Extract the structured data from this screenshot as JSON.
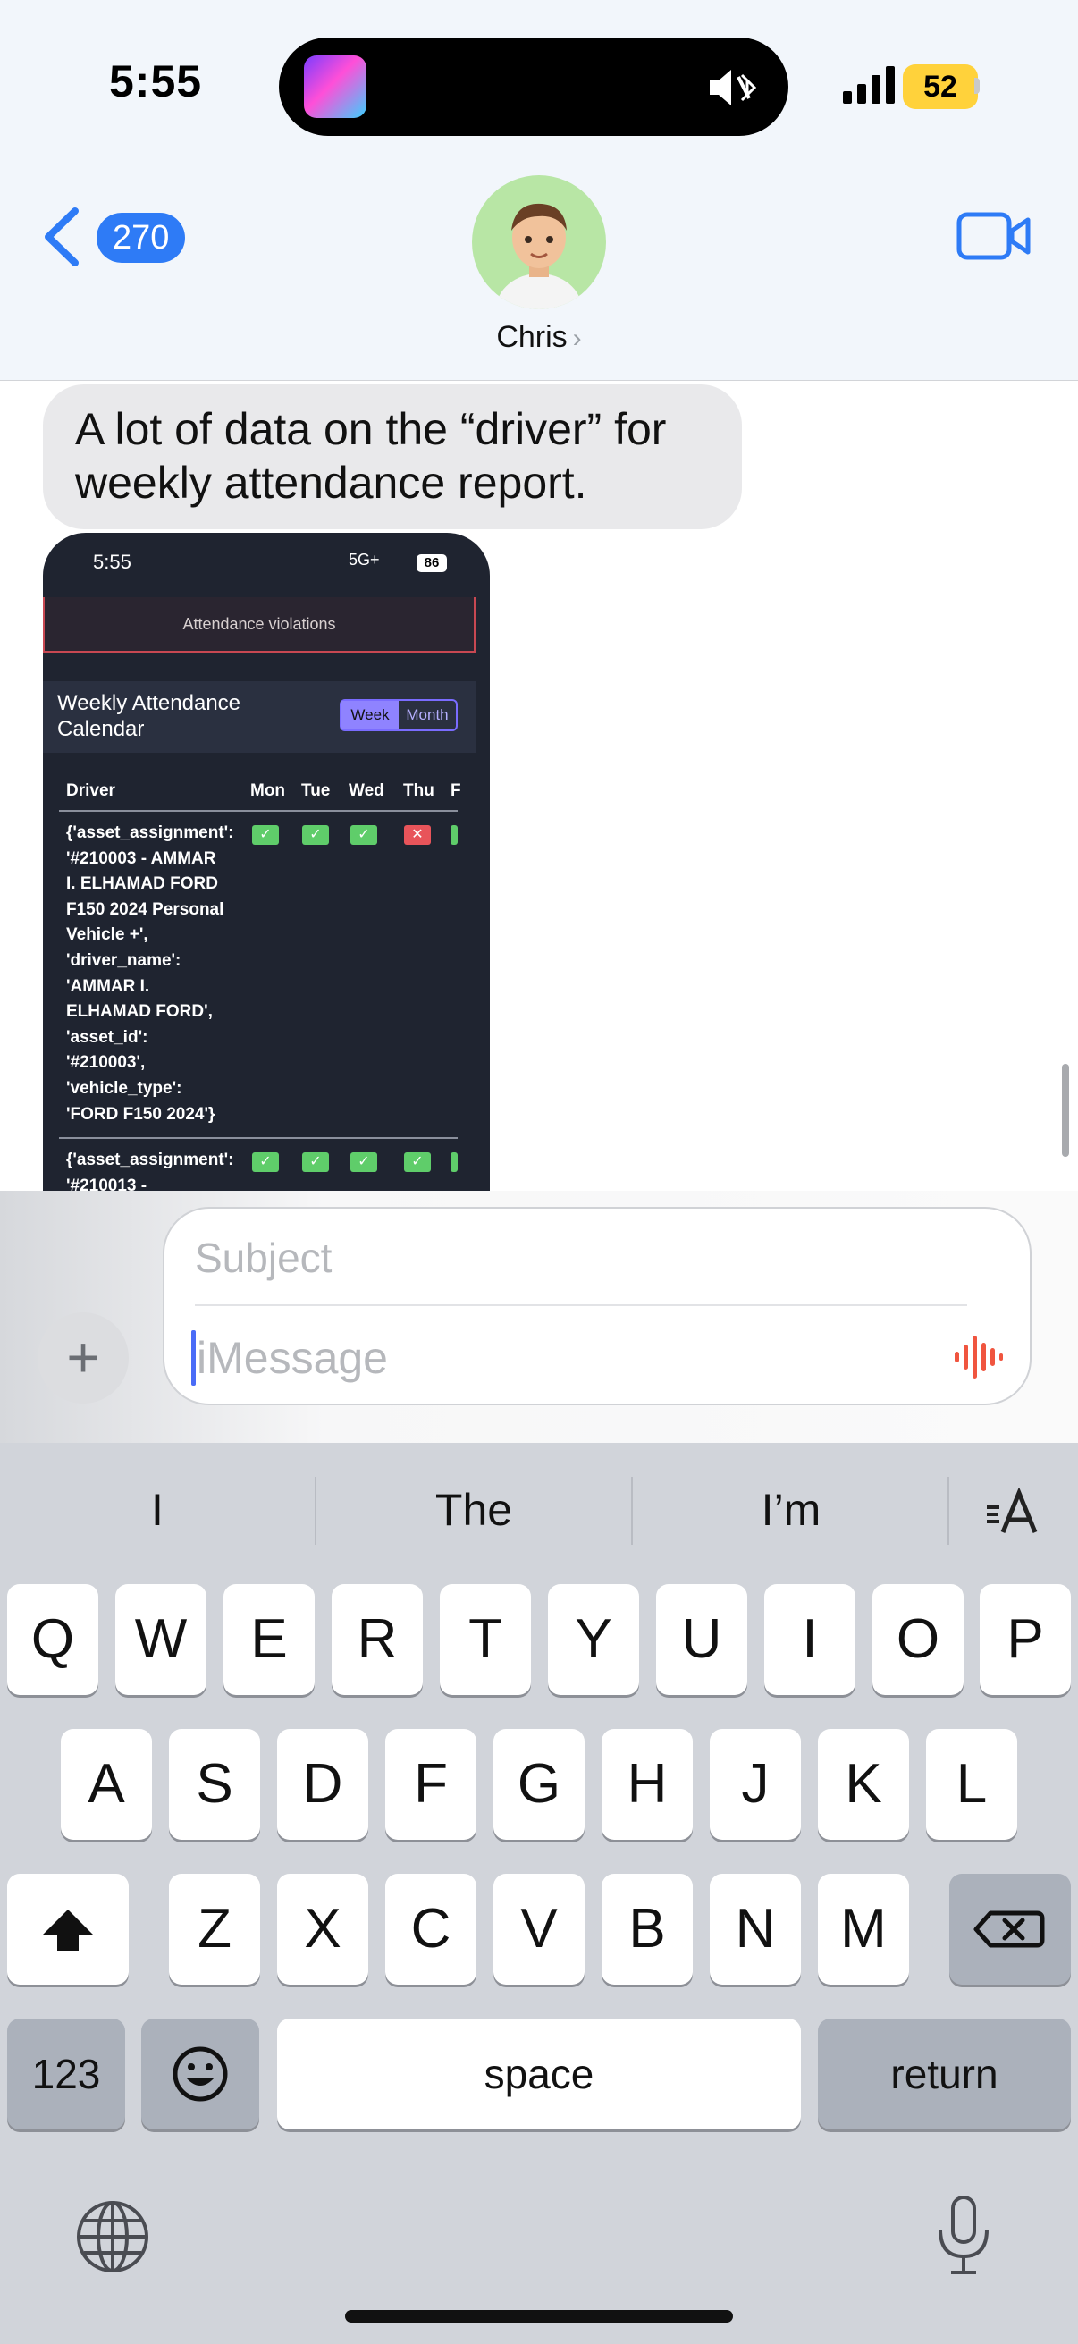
{
  "status_bar": {
    "time": "5:55",
    "battery": "52"
  },
  "header": {
    "back_count": "270",
    "contact_name": "Chris",
    "name_chevron": "›"
  },
  "messages": {
    "bubble_text": "A lot of data on the “driver” for weekly attendance report.",
    "screenshot": {
      "time": "5:55",
      "network": "5G+",
      "battery": "86",
      "alert_text": "Attendance violations",
      "panel_title": "Weekly Attendance Calendar",
      "toggle": {
        "week": "Week",
        "month": "Month",
        "selected": "Week"
      },
      "columns": [
        "Driver",
        "Mon",
        "Tue",
        "Wed",
        "Thu",
        "F"
      ],
      "rows": [
        {
          "driver": "{'asset_assignment':\n'#210003 - AMMAR\nI. ELHAMAD FORD\nF150 2024 Personal\nVehicle +',\n'driver_name':\n'AMMAR I.\nELHAMAD FORD',\n'asset_id':\n'#210003',\n'vehicle_type':\n'FORD F150 2024'}",
          "mon": "✓",
          "tue": "✓",
          "wed": "✓",
          "thu": "✕"
        },
        {
          "driver": "{'asset_assignment':\n'#210013 -",
          "mon": "✓",
          "tue": "✓",
          "wed": "✓",
          "thu": "✓"
        }
      ],
      "colors": {
        "present": "#5fcd6a",
        "absent": "#e8545a",
        "accent": "#8f83ff"
      }
    }
  },
  "compose": {
    "subject_placeholder": "Subject",
    "message_placeholder": "iMessage",
    "plus": "+"
  },
  "keyboard": {
    "predictions": [
      "I",
      "The",
      "I’m"
    ],
    "row1": [
      "Q",
      "W",
      "E",
      "R",
      "T",
      "Y",
      "U",
      "I",
      "O",
      "P"
    ],
    "row2": [
      "A",
      "S",
      "D",
      "F",
      "G",
      "H",
      "J",
      "K",
      "L"
    ],
    "row3": [
      "Z",
      "X",
      "C",
      "V",
      "B",
      "N",
      "M"
    ],
    "numbers_key": "123",
    "space_key": "space",
    "return_key": "return"
  },
  "icons": [
    "back-chevron-icon",
    "video-call-icon",
    "speaker-mute-icon",
    "bluetooth-icon",
    "signal-icon",
    "audio-wave-icon",
    "shift-icon",
    "delete-icon",
    "emoji-icon",
    "globe-icon",
    "microphone-icon",
    "text-format-icon"
  ],
  "colors": {
    "accent_blue": "#2e7bf6",
    "battery_yellow": "#ffd23b",
    "wave_orange": "#f0553f"
  }
}
